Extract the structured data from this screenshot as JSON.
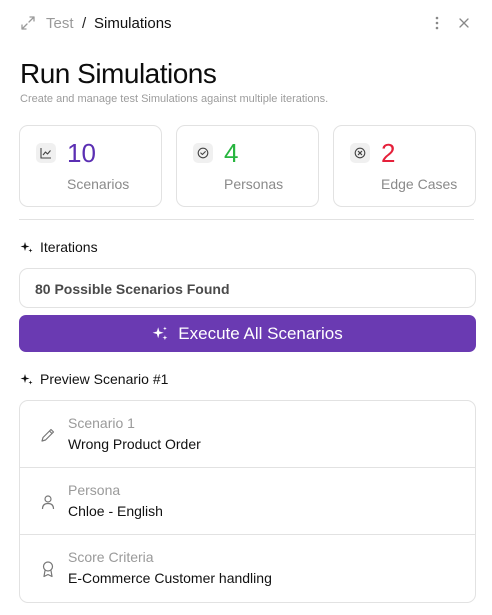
{
  "breadcrumb": {
    "parent": "Test",
    "separator": "/",
    "current": "Simulations"
  },
  "header": {
    "title": "Run Simulations",
    "subtitle": "Create and manage test Simulations against multiple iterations."
  },
  "stats": [
    {
      "value": "10",
      "label": "Scenarios",
      "icon": "chart-icon",
      "color": "#5b2fb3"
    },
    {
      "value": "4",
      "label": "Personas",
      "icon": "check-circle-icon",
      "color": "#27b53f"
    },
    {
      "value": "2",
      "label": "Edge Cases",
      "icon": "x-circle-icon",
      "color": "#e5203a"
    }
  ],
  "iterations": {
    "label": "Iterations",
    "found_text": "80 Possible Scenarios Found"
  },
  "execute_button": {
    "label": "Execute All Scenarios",
    "color": "#6a3ab2"
  },
  "preview": {
    "label": "Preview Scenario #1",
    "rows": [
      {
        "label": "Scenario 1",
        "value": "Wrong Product Order",
        "icon": "pencil-icon"
      },
      {
        "label": "Persona",
        "value": "Chloe - English",
        "icon": "person-icon"
      },
      {
        "label": "Score Criteria",
        "value": "E-Commerce Customer handling",
        "icon": "award-icon"
      }
    ]
  }
}
